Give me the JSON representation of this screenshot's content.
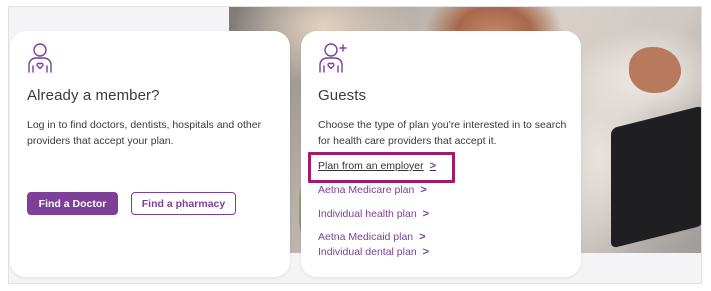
{
  "colors": {
    "brand_purple": "#7d3f98",
    "highlight_magenta": "#a01a6e",
    "text": "#3a3a3a"
  },
  "member_card": {
    "icon": "person-heart-icon",
    "title": "Already a member?",
    "description": "Log in to find doctors, dentists, hospitals and other providers that accept your plan.",
    "find_doctor_label": "Find a Doctor",
    "find_pharmacy_label": "Find a pharmacy"
  },
  "guests_card": {
    "icon": "person-heart-plus-icon",
    "title": "Guests",
    "description": "Choose the type of plan you're interested in to search for health care providers that accept it.",
    "plans": [
      {
        "label": "Plan from an employer",
        "highlighted": true
      },
      {
        "label": "Aetna Medicare plan"
      },
      {
        "label": "Individual health plan"
      },
      {
        "label": "Aetna Medicaid plan"
      },
      {
        "label": "Individual dental plan"
      }
    ],
    "chevron": ">"
  }
}
